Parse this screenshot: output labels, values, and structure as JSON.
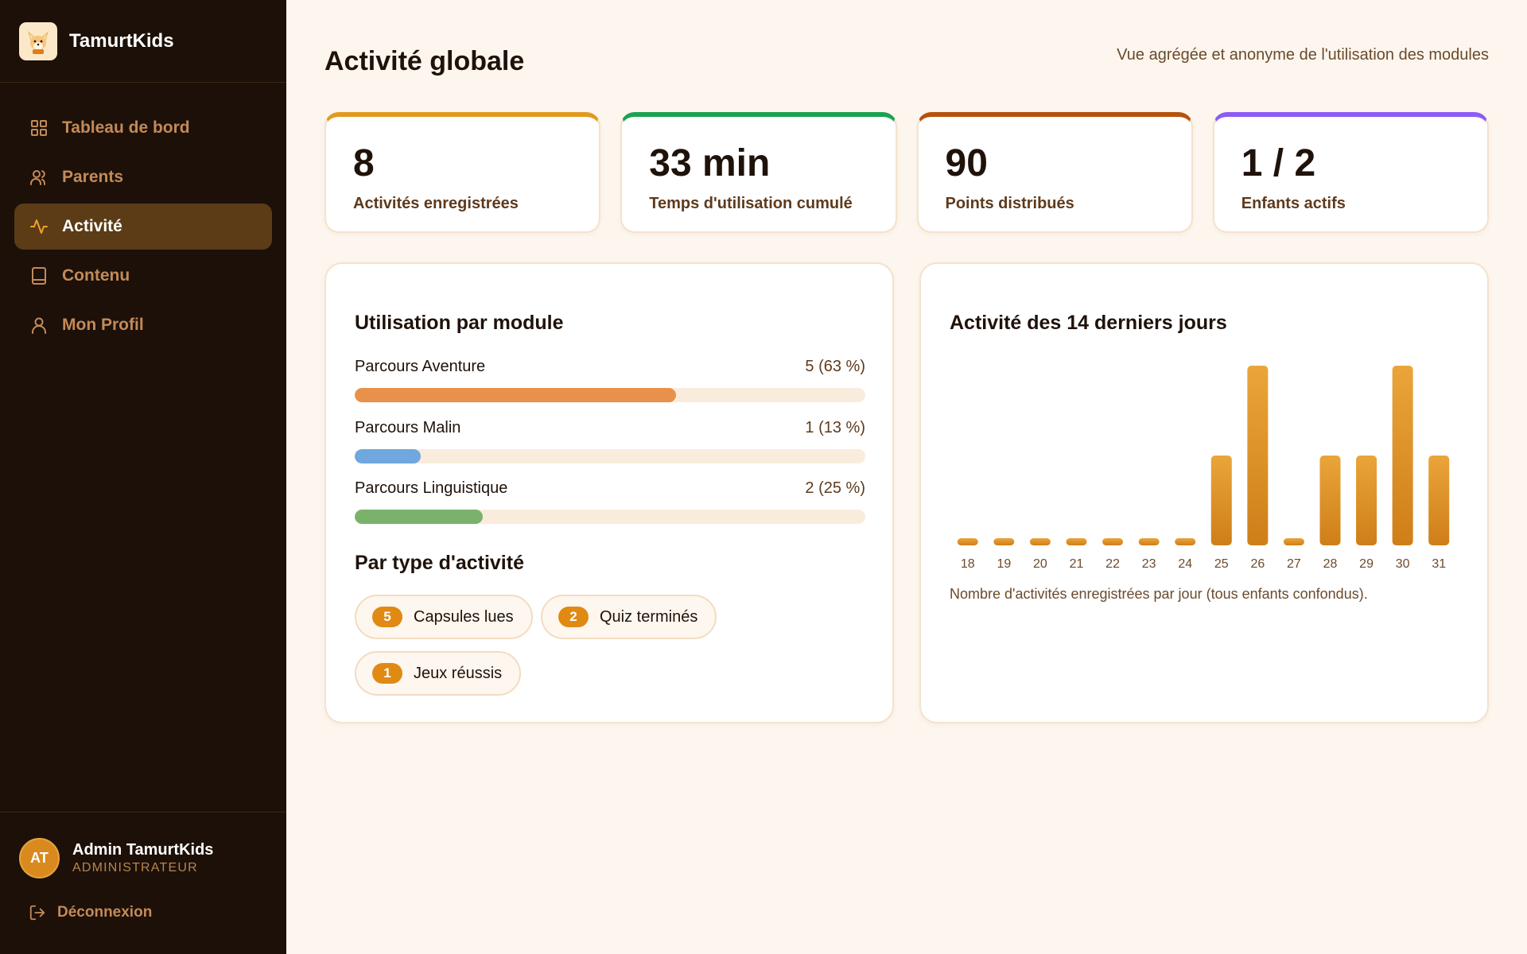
{
  "brand": {
    "name": "TamurtKids",
    "logo_icon": "fennec-fox-icon"
  },
  "nav": {
    "items": [
      {
        "label": "Tableau de bord",
        "icon": "grid-icon",
        "active": false
      },
      {
        "label": "Parents",
        "icon": "users-icon",
        "active": false
      },
      {
        "label": "Activité",
        "icon": "activity-icon",
        "active": true
      },
      {
        "label": "Contenu",
        "icon": "book-icon",
        "active": false
      },
      {
        "label": "Mon Profil",
        "icon": "user-icon",
        "active": false
      }
    ]
  },
  "user": {
    "initials": "AT",
    "name": "Admin TamurtKids",
    "role": "ADMINISTRATEUR"
  },
  "logout": {
    "label": "Déconnexion",
    "icon": "logout-icon"
  },
  "page": {
    "title": "Activité globale",
    "subtitle": "Vue agrégée et anonyme de l'utilisation des modules"
  },
  "stats": [
    {
      "value": "8",
      "label": "Activités enregistrées",
      "accent": "#e09a1e"
    },
    {
      "value": "33 min",
      "label": "Temps d'utilisation cumulé",
      "accent": "#1aa351"
    },
    {
      "value": "90",
      "label": "Points distribués",
      "accent": "#b5520c"
    },
    {
      "value": "1 / 2",
      "label": "Enfants actifs",
      "accent": "#8b5cf6"
    }
  ],
  "modules": {
    "title": "Utilisation par module",
    "items": [
      {
        "name": "Parcours Aventure",
        "value": "5 (63 %)",
        "ratio": 0.63,
        "color": "#e8914a"
      },
      {
        "name": "Parcours Malin",
        "value": "1 (13 %)",
        "ratio": 0.13,
        "color": "#6fa7de"
      },
      {
        "name": "Parcours Linguistique",
        "value": "2 (25 %)",
        "ratio": 0.25,
        "color": "#7ab26b"
      }
    ]
  },
  "types": {
    "title": "Par type d'activité",
    "items": [
      {
        "count": "5",
        "label": "Capsules lues"
      },
      {
        "count": "2",
        "label": "Quiz terminés"
      },
      {
        "count": "1",
        "label": "Jeux réussis"
      }
    ]
  },
  "activity_chart": {
    "title": "Activité des 14 derniers jours",
    "caption": "Nombre d'activités enregistrées par jour (tous enfants confondus).",
    "color_top": "#eaa53a",
    "color_bottom": "#cf7e18"
  },
  "chart_data": {
    "type": "bar",
    "title": "Activité des 14 derniers jours",
    "categories": [
      "18",
      "19",
      "20",
      "21",
      "22",
      "23",
      "24",
      "25",
      "26",
      "27",
      "28",
      "29",
      "30",
      "31"
    ],
    "values": [
      0,
      0,
      0,
      0,
      0,
      0,
      0,
      1,
      2,
      0,
      1,
      1,
      2,
      1
    ],
    "ylim": [
      0,
      2
    ],
    "grid": false,
    "legend": "none"
  }
}
